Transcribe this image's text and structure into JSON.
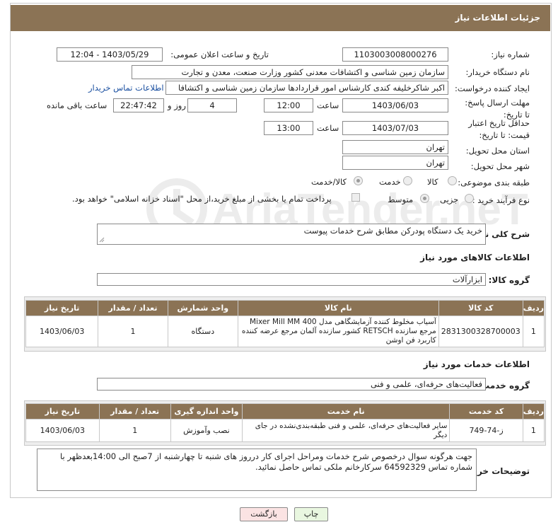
{
  "header": {
    "title": "جزئیات اطلاعات نیاز"
  },
  "need_number": {
    "label": "شماره نیاز:",
    "value": "1103003008000276"
  },
  "announce_datetime": {
    "label": "تاریخ و ساعت اعلان عمومی:",
    "value": "1403/05/29 - 12:04"
  },
  "buyer_org": {
    "label": "نام دستگاه خریدار:",
    "value": "سازمان زمین شناسی و اکتشافات معدنی کشور وزارت صنعت، معدن و تجارت"
  },
  "requester": {
    "label": "ایجاد کننده درخواست:",
    "value": "اکبر شاکرخلیفه کندی کارشناس امور قراردادها سازمان زمین شناسی و اکتشافا",
    "contact_link": "اطلاعات تماس خریدار"
  },
  "reply_deadline": {
    "label": "مهلت ارسال پاسخ: تا تاریخ:",
    "date": "1403/06/03",
    "time_label": "ساعت",
    "time": "12:00",
    "days": "4",
    "days_label": "روز و",
    "remaining": "22:47:42",
    "remaining_label": "ساعت باقی مانده"
  },
  "price_validity": {
    "label": "حداقل تاریخ اعتبار قیمت: تا تاریخ:",
    "date": "1403/07/03",
    "time_label": "ساعت",
    "time": "13:00"
  },
  "province": {
    "label": "استان محل تحویل:",
    "value": "تهران"
  },
  "city": {
    "label": "شهر محل تحویل:",
    "value": "تهران"
  },
  "category": {
    "label": "طبقه بندی موضوعی:",
    "options": [
      "کالا",
      "خدمت",
      "کالا/خدمت"
    ],
    "selected": 2
  },
  "purchase_type": {
    "label": "نوع فرآیند خرید :",
    "options": [
      "جزیی",
      "متوسط"
    ],
    "selected": 1,
    "payment_note": "پرداخت تمام یا بخشی از مبلغ خرید،از محل \"اسناد خزانه اسلامی\" خواهد بود."
  },
  "description": {
    "label": "شرح کلی نیاز:",
    "value": "خرید یک دستگاه پودرکن مطابق شرح خدمات پیوست"
  },
  "goods_section": {
    "title": "اطلاعات کالاهای مورد نیاز",
    "group_label": "گروه کالا:",
    "group_value": "ابزارآلات"
  },
  "goods_table": {
    "headers": [
      "ردیف",
      "کد کالا",
      "نام کالا",
      "واحد شمارش",
      "تعداد / مقدار",
      "تاریخ نیاز"
    ],
    "rows": [
      [
        "1",
        "2831300328700003",
        "آسیاب مخلوط کننده آزمایشگاهی مدل Mixer Mill MM 400 مرجع سازنده RETSCH کشور سازنده آلمان مرجع عرضه کننده کاربرد فن اوشن",
        "دستگاه",
        "1",
        "1403/06/03"
      ]
    ]
  },
  "services_section": {
    "title": "اطلاعات خدمات مورد نیاز",
    "group_label": "گروه خدمت:",
    "group_value": "فعالیت‌های حرفه‌ای، علمی و فنی"
  },
  "services_table": {
    "headers": [
      "ردیف",
      "کد خدمت",
      "نام خدمت",
      "واحد اندازه گیری",
      "تعداد / مقدار",
      "تاریخ نیاز"
    ],
    "rows": [
      [
        "1",
        "ز-74-749",
        "سایر فعالیت‌های حرفه‌ای، علمی و فنی طبقه‌بندی‌نشده در جای دیگر",
        "نصب وآموزش",
        "1",
        "1403/06/03"
      ]
    ]
  },
  "buyer_notes": {
    "label": "توضیحات خریدار:",
    "value": "جهت هرگونه سوال درخصوص شرح خدمات ومراحل اجرای کار درروز های شنبه تا چهارشنبه از 7صبح الی 14:00بعدظهر با شماره تماس 64592329 سرکارخانم ملکی تماس حاصل نمائید."
  },
  "buttons": {
    "print": "چاپ",
    "back": "بازگشت"
  },
  "watermark": {
    "text": "AriaTender.neT"
  },
  "colors": {
    "header_bg": "#8b7355",
    "link": "#1a4fa0",
    "print_btn": "#e9f7e0",
    "back_btn": "#fbe3e3"
  }
}
